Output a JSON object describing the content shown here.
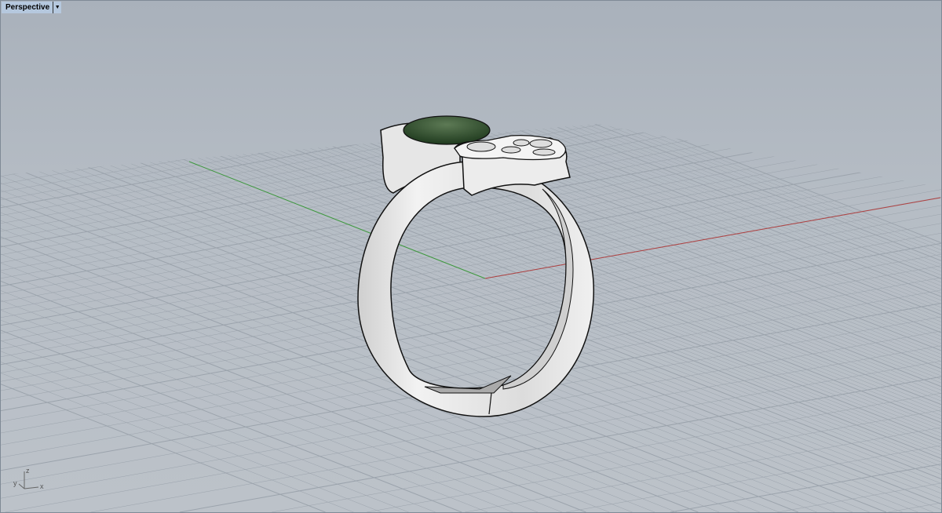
{
  "viewport": {
    "name": "Perspective",
    "menu_icon": "dropdown-arrow-icon"
  },
  "axes_widget": {
    "x": "x",
    "y": "y",
    "z": "z"
  },
  "colors": {
    "x_axis": "#b04040",
    "y_axis": "#3f9a3f",
    "grid": "#9ba3ac",
    "gem": "#2c4a2a",
    "metal": "#e8e8e8"
  }
}
